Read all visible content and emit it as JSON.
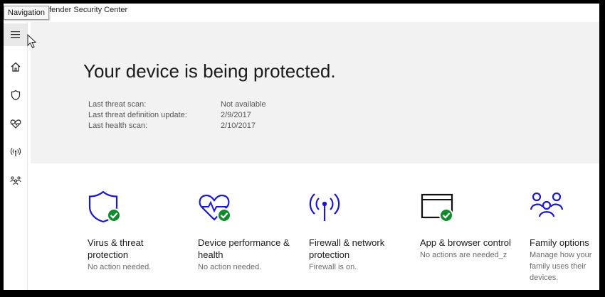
{
  "window": {
    "title": "Windows Defender Security Center",
    "visible_title": "efender Security Center",
    "tooltip": "Navigation"
  },
  "colors": {
    "accent": "#1a18c8",
    "check": "#138a2e",
    "hero_bg": "#f2f2f2"
  },
  "sidebar": {
    "items": [
      {
        "name": "menu",
        "icon": "hamburger-icon"
      },
      {
        "name": "home",
        "icon": "home-icon"
      },
      {
        "name": "virus-threat",
        "icon": "shield-icon"
      },
      {
        "name": "device-health",
        "icon": "heart-icon"
      },
      {
        "name": "firewall",
        "icon": "antenna-icon"
      },
      {
        "name": "family",
        "icon": "family-icon"
      }
    ]
  },
  "hero": {
    "title": "Your device is being protected.",
    "scans": [
      {
        "label": "Last threat scan:",
        "value": "Not available"
      },
      {
        "label": "Last threat definition update:",
        "value": "2/9/2017"
      },
      {
        "label": "Last health scan:",
        "value": "2/10/2017"
      }
    ]
  },
  "tiles": [
    {
      "title": "Virus & threat protection",
      "status": "No action needed.",
      "icon": "shield-check-icon"
    },
    {
      "title": "Device performance & health",
      "status": "No action needed.",
      "icon": "heart-check-icon"
    },
    {
      "title": "Firewall & network protection",
      "status": "Firewall is on.",
      "icon": "antenna-icon"
    },
    {
      "title": "App & browser control",
      "status": "No actions are needed_z",
      "icon": "browser-check-icon"
    },
    {
      "title": "Family options",
      "status": "Manage how your family uses their devices.",
      "icon": "family-icon"
    }
  ]
}
